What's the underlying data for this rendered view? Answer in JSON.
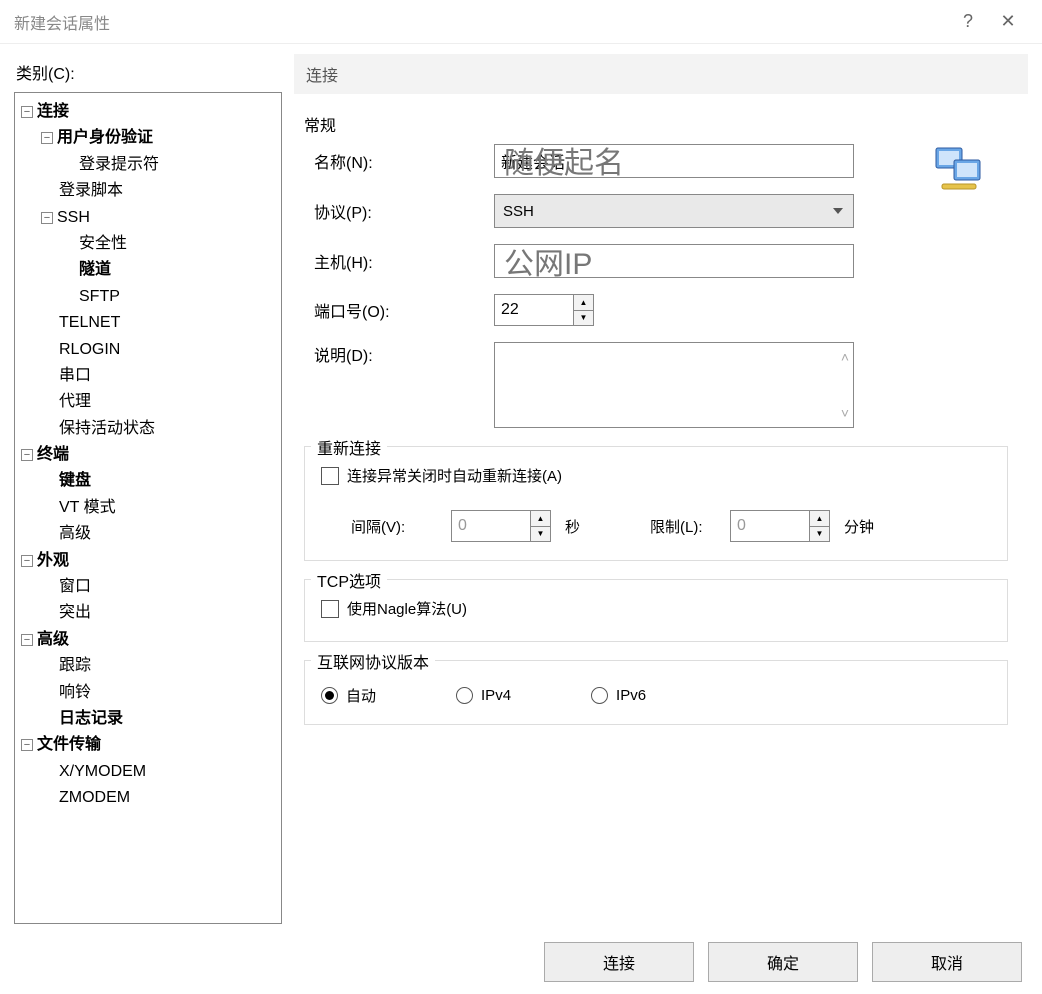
{
  "titlebar": {
    "title": "新建会话属性"
  },
  "category_label": "类别(C):",
  "tree": {
    "connection": "连接",
    "auth": "用户身份验证",
    "login_prompt": "登录提示符",
    "login_script": "登录脚本",
    "ssh": "SSH",
    "security": "安全性",
    "tunnel": "隧道",
    "sftp": "SFTP",
    "telnet": "TELNET",
    "rlogin": "RLOGIN",
    "serial": "串口",
    "proxy": "代理",
    "keepalive": "保持活动状态",
    "terminal": "终端",
    "keyboard": "键盘",
    "vtmode": "VT 模式",
    "term_adv": "高级",
    "appearance": "外观",
    "window": "窗口",
    "highlight": "突出",
    "advanced": "高级",
    "trace": "跟踪",
    "bell": "响铃",
    "logging": "日志记录",
    "filetransfer": "文件传输",
    "xymodem": "X/YMODEM",
    "zmodem": "ZMODEM"
  },
  "panel_title": "连接",
  "general": {
    "title": "常规",
    "name_label": "名称(N):",
    "name_value": "新建会话",
    "name_overlay": "随便起名",
    "protocol_label": "协议(P):",
    "protocol_value": "SSH",
    "host_label": "主机(H):",
    "host_value": "",
    "host_overlay": "公网IP",
    "port_label": "端口号(O):",
    "port_value": "22",
    "desc_label": "说明(D):"
  },
  "reconnect": {
    "title": "重新连接",
    "auto_label": "连接异常关闭时自动重新连接(A)",
    "interval_label": "间隔(V):",
    "interval_value": "0",
    "interval_unit": "秒",
    "limit_label": "限制(L):",
    "limit_value": "0",
    "limit_unit": "分钟"
  },
  "tcp": {
    "title": "TCP选项",
    "nagle_label": "使用Nagle算法(U)"
  },
  "ipver": {
    "title": "互联网协议版本",
    "auto": "自动",
    "ipv4": "IPv4",
    "ipv6": "IPv6"
  },
  "buttons": {
    "connect": "连接",
    "ok": "确定",
    "cancel": "取消"
  }
}
